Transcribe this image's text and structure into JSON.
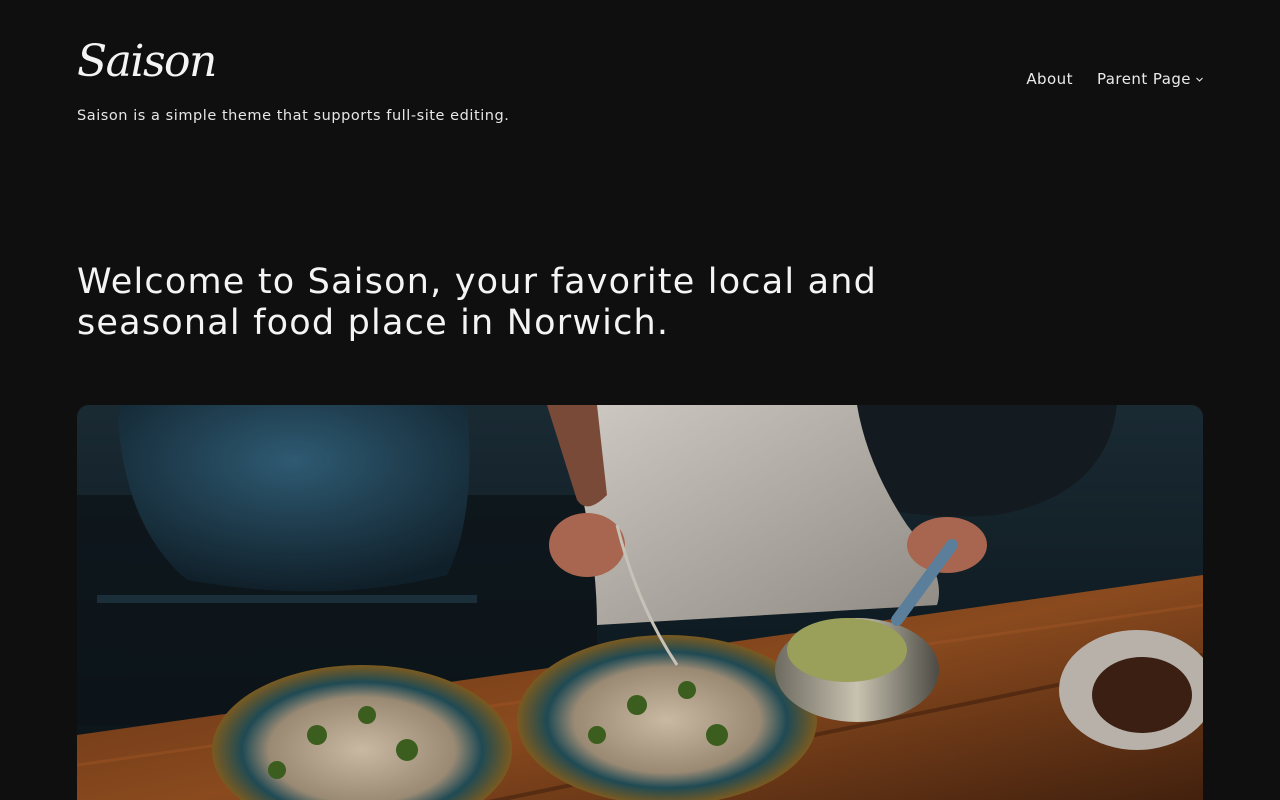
{
  "site": {
    "title": "Saison",
    "tagline": "Saison is a simple theme that supports full-site editing."
  },
  "nav": {
    "items": [
      {
        "label": "About"
      },
      {
        "label": "Parent Page",
        "icon": "chevron-down-icon"
      }
    ]
  },
  "hero": {
    "headline": "Welcome to Saison, your favorite local and seasonal food place in Norwich."
  },
  "colors": {
    "background": "#0f0f0f",
    "text": "#f4f4f4"
  }
}
